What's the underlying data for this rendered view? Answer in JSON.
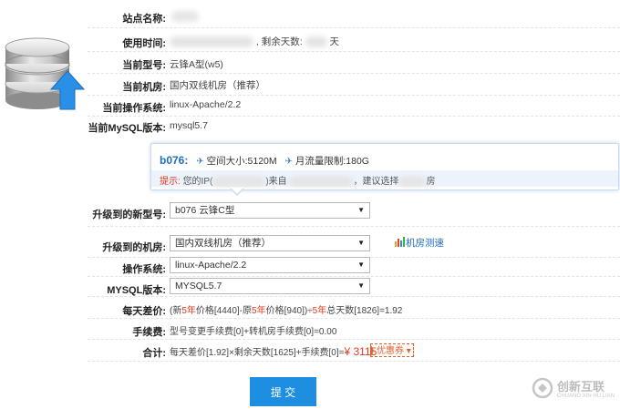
{
  "info": {
    "site_name_label": "站点名称:",
    "use_time_label": "使用时间:",
    "remaining_days_text": ", 剩余天数:",
    "remaining_days_tail": "天",
    "current_model_label": "当前型号:",
    "current_model_value": "云锋A型(w5)",
    "current_room_label": "当前机房:",
    "current_room_value": "国内双线机房（推荐）",
    "current_os_label": "当前操作系统:",
    "current_os_value": "linux-Apache/2.2",
    "current_mysql_label": "当前MySQL版本:",
    "current_mysql_value": "mysql5.7"
  },
  "tip": {
    "code": "b076:",
    "space": "空间大小:5120M",
    "traffic": "月流量限制:180G",
    "notice_prefix": "提示:",
    "notice_a": "您的IP(",
    "notice_b": ")来自",
    "notice_c": "，建议选择",
    "notice_d": "房"
  },
  "form": {
    "upgrade_model_label": "升级到的新型号:",
    "upgrade_model_value": "b076 云锋C型",
    "upgrade_room_label": "升级到的机房:",
    "upgrade_room_value": "国内双线机房（推荐）",
    "room_speed_link": "机房测速",
    "os_label": "操作系统:",
    "os_value": "linux-Apache/2.2",
    "mysql_label": "MYSQL版本:",
    "mysql_value": "MYSQL5.7"
  },
  "price": {
    "daily_diff_label": "每天差价:",
    "d1": "(新",
    "d2": "5年",
    "d3": "价格[4440]-原",
    "d4": "5年",
    "d5": "价格[940])÷",
    "d6": "5年",
    "d7": "总天数[1826]=1.92",
    "fee_label": "手续费:",
    "fee_value": "型号变更手续费[0]+转机房手续费[0]=0.00",
    "total_label": "合计:",
    "total_formula": "每天差价[1.92]×剩余天数[1625]+手续费[0]=",
    "total_amount": "¥ 3115",
    "coupon_label": "优惠券 ▾"
  },
  "submit_label": "提 交",
  "watermark": {
    "cn": "创新互联",
    "en": "CHUANG XIN HU LIAN"
  },
  "colors": {
    "accent": "#1e8fe0",
    "price_red": "#e03a1e",
    "tip_bg": "#ecf3fb"
  }
}
